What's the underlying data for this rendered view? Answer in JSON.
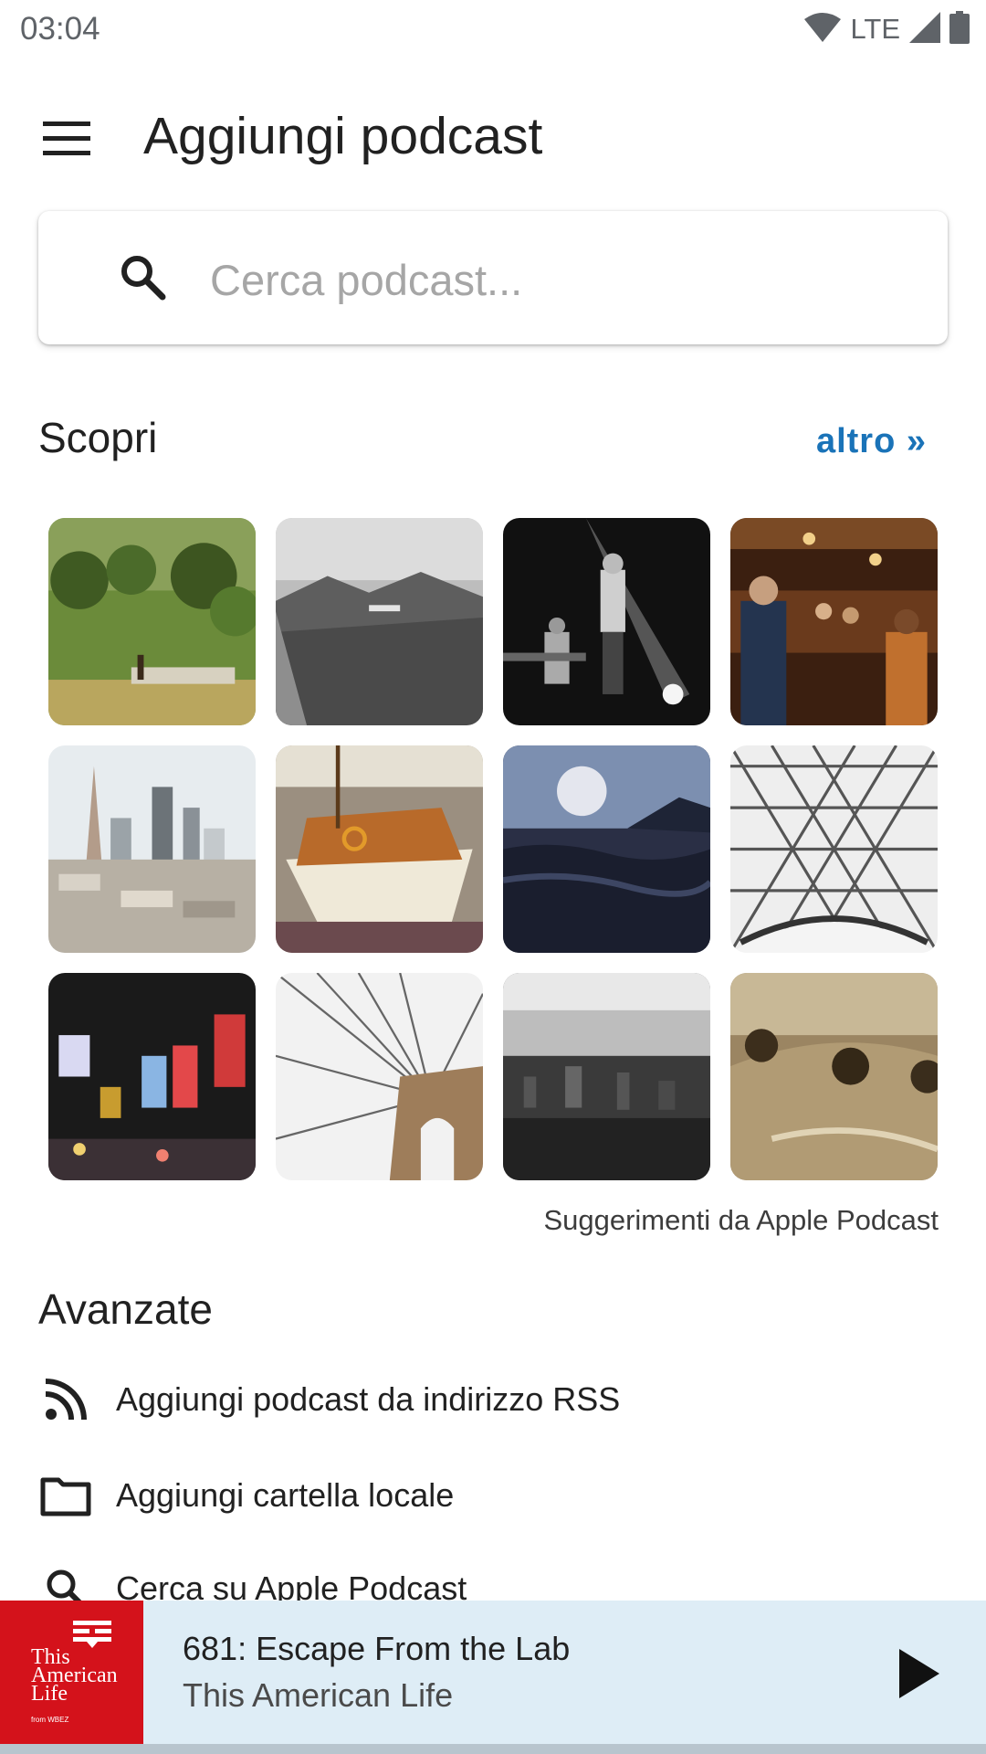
{
  "status": {
    "time": "03:04",
    "network": "LTE"
  },
  "toolbar": {
    "title": "Aggiungi podcast"
  },
  "search": {
    "placeholder": "Cerca podcast..."
  },
  "discover": {
    "title": "Scopri",
    "more_label": "altro »",
    "credit": "Suggerimenti da Apple Podcast"
  },
  "advanced": {
    "title": "Avanzate",
    "items": [
      {
        "label": "Aggiungi podcast da indirizzo RSS",
        "icon": "rss-icon"
      },
      {
        "label": "Aggiungi cartella locale",
        "icon": "folder-icon"
      },
      {
        "label": "Cerca su Apple Podcast",
        "icon": "search-icon"
      }
    ]
  },
  "player": {
    "episode_title": "681: Escape From the Lab",
    "podcast_title": "This American Life",
    "cover_text": "This American Life",
    "cover_small": "from WBEZ",
    "accent": "#d4121b"
  }
}
